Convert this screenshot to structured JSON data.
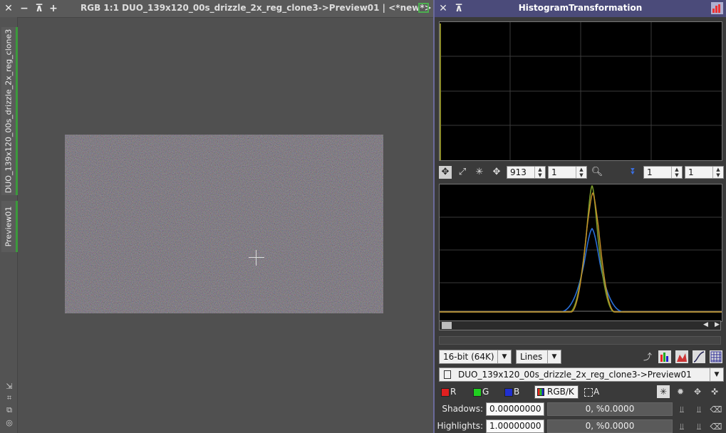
{
  "image_window": {
    "title": "RGB 1:1 DUO_139x120_00s_drizzle_2x_reg_clone3->Preview01 | <*new*>",
    "tabs": [
      {
        "label": "DUO_139x120_00s_drizzle_2x_reg_clone3"
      },
      {
        "label": "Preview01"
      }
    ],
    "icons": [
      "close-icon",
      "minimize-icon",
      "shade-icon",
      "maximize-icon",
      "panel-icon"
    ],
    "side_tools": [
      "zoom-in-icon",
      "fit-icon",
      "copy-icon",
      "target-icon"
    ]
  },
  "histogram_window": {
    "title": "HistogramTransformation",
    "zoom": {
      "horizontal_value": "913",
      "vertical_value": "1",
      "output_h": "1",
      "output_v": "1"
    },
    "bit_depth": "16-bit (64K)",
    "graph_style": "Lines",
    "view_target": "DUO_139x120_00s_drizzle_2x_reg_clone3->Preview01",
    "channels": [
      {
        "key": "r",
        "label": "R",
        "color": "#e02020"
      },
      {
        "key": "g",
        "label": "G",
        "color": "#20d020"
      },
      {
        "key": "b",
        "label": "B",
        "color": "#2030d0"
      },
      {
        "key": "rgbk",
        "label": "RGB/K"
      },
      {
        "key": "a",
        "label": "A"
      }
    ],
    "shadows": {
      "label": "Shadows:",
      "value": "0.00000000",
      "clipping": "0, %0.0000"
    },
    "highlights": {
      "label": "Highlights:",
      "value": "1.00000000",
      "clipping": "0, %0.0000"
    }
  }
}
